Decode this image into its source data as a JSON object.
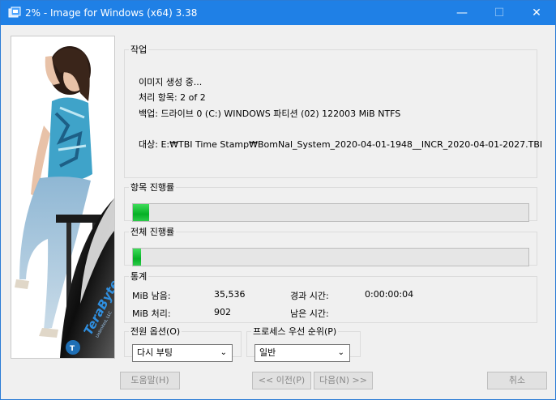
{
  "window": {
    "title": "2% - Image for Windows (x64) 3.38",
    "min_glyph": "—",
    "max_glyph": "☐",
    "close_glyph": "✕"
  },
  "banner": {
    "brand": "TeraByte",
    "brand_sub": "Unlimited, LLC"
  },
  "work": {
    "legend": "작업",
    "status": "이미지 생성 중...",
    "item_line": "처리 항목: 2 of 2",
    "backup_line": "백업: 드라이브 0 (C:) WINDOWS 파티션 (02) 122003 MiB NTFS",
    "target_line": "대상: E:₩TBI Time Stamp₩BomNal_System_2020-04-01-1948__INCR_2020-04-01-2027.TBI"
  },
  "item_progress": {
    "legend": "항목 진행률",
    "fraction": 0.04
  },
  "total_progress": {
    "legend": "전체 진행률",
    "fraction": 0.02
  },
  "stats": {
    "legend": "통계",
    "mib_left_label": "MiB 남음:",
    "mib_left_value": "35,536",
    "mib_done_label": "MiB 처리:",
    "mib_done_value": "902",
    "elapsed_label": "경과 시간:",
    "elapsed_value": "0:00:00:04",
    "remaining_label": "남은 시간:",
    "remaining_value": ""
  },
  "power": {
    "legend": "전원 옵션(O)",
    "selected": "다시 부팅"
  },
  "priority": {
    "legend": "프로세스 우선 순위(P)",
    "selected": "일반"
  },
  "buttons": {
    "help": "도움말(H)",
    "back": "<< 이전(P)",
    "next": "다음(N) >>",
    "cancel": "취소"
  },
  "colors": {
    "titlebar": "#1f80e6",
    "progress_green": "#06b025"
  }
}
